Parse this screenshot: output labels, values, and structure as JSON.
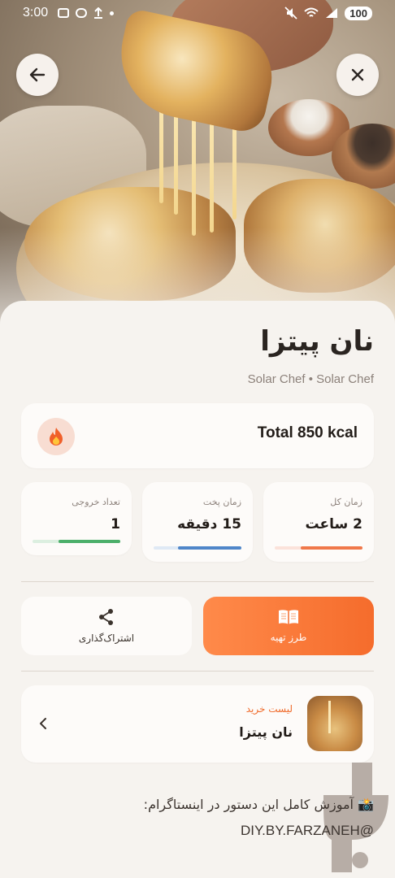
{
  "status_bar": {
    "time": "3:00",
    "battery": "100"
  },
  "recipe": {
    "title": "نان پیتزا",
    "author": "Solar Chef • Solar Chef",
    "calories": "Total 850 kcal"
  },
  "stats": [
    {
      "label": "زمان کل",
      "value": "2 ساعت",
      "progress": 0.7,
      "track_color": "#fbe2da",
      "fill_color": "#f0784a"
    },
    {
      "label": "زمان پخت",
      "value": "15 دقیقه",
      "progress": 0.72,
      "track_color": "#dfe9f5",
      "fill_color": "#4f86c9"
    },
    {
      "label": "تعداد خروجی",
      "value": "1",
      "progress": 0.7,
      "track_color": "#dcefe0",
      "fill_color": "#4caf6a"
    }
  ],
  "actions": {
    "prepare_label": "طرز تهیه",
    "share_label": "اشتراک‌گذاری"
  },
  "shopping": {
    "label": "لیست خرید",
    "title": "نان پیتزا"
  },
  "footer": {
    "instagram_line": "📸 آموزش کامل این دستور در اینستاگرام:",
    "handle": "DIY.BY.FARZANEH@"
  },
  "colors": {
    "accent": "#f56c2c",
    "background": "#f6f3ef",
    "card": "#fdfbf9"
  },
  "icons": [
    "back-arrow-icon",
    "close-icon",
    "fire-icon",
    "share-icon",
    "book-icon",
    "chevron-left-icon"
  ]
}
